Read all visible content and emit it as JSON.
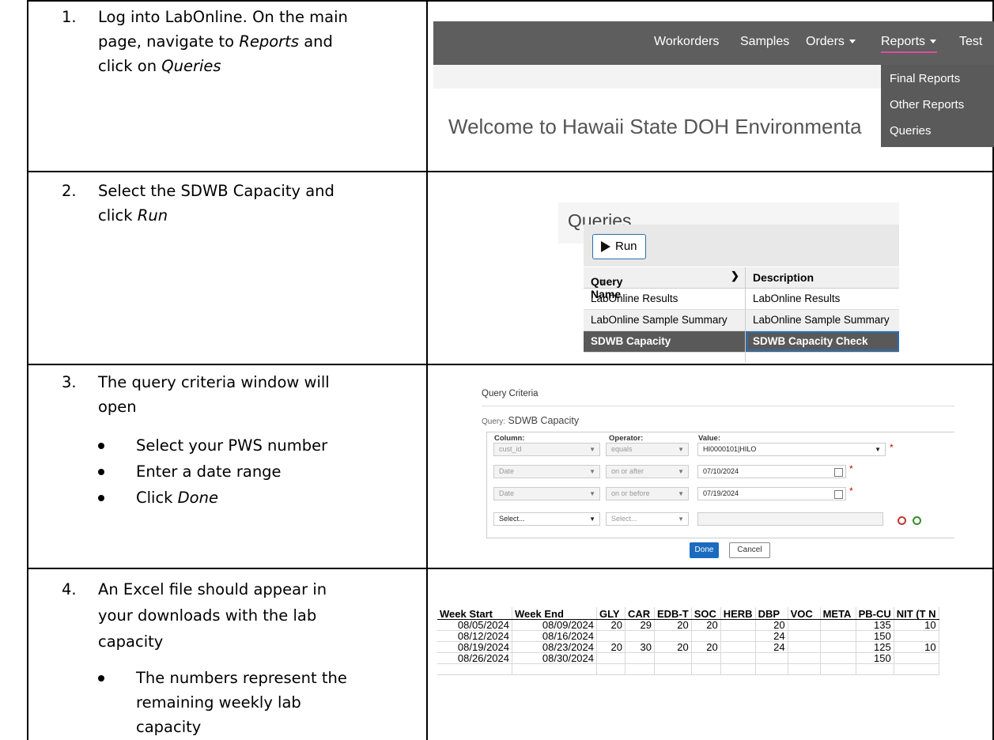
{
  "steps": [
    {
      "num": "1.",
      "line1": "Log into LabOnline. On the main",
      "line2_pre": "page, navigate to ",
      "line2_em": "Reports",
      "line2_post": " and",
      "line3_pre": "click on ",
      "line3_em": "Queries"
    },
    {
      "num": "2.",
      "line1": "Select the SDWB Capacity and",
      "line2_pre": "click ",
      "line2_em": "Run"
    },
    {
      "num": "3.",
      "line1": "The query criteria  window will",
      "line2": "open",
      "bullets": [
        "Select your PWS number",
        "Enter a date range"
      ],
      "bullet3_pre": "Click ",
      "bullet3_em": "Done"
    },
    {
      "num": "4.",
      "line1": "An Excel file should appear in",
      "line2": "your downloads with the lab",
      "line3": "capacity",
      "bullet_lines": [
        "The numbers represent the",
        "remaining weekly lab",
        "capacity"
      ]
    }
  ],
  "shot1": {
    "nav": [
      "Workorders",
      "Samples",
      "Orders",
      "Reports",
      "Test"
    ],
    "dropdown": [
      "Final Reports",
      "Other Reports",
      "Queries"
    ],
    "welcome": "Welcome to Hawaii State DOH Environmenta"
  },
  "shot2": {
    "title": "Queries",
    "run_label": "Run",
    "col_name": "Query Name",
    "col_sort": "↑",
    "col_desc": "Description",
    "rows": [
      {
        "name": "LabOnline Results",
        "desc": "LabOnline Results"
      },
      {
        "name": "LabOnline Sample Summary",
        "desc": "LabOnline Sample Summary"
      },
      {
        "name": "SDWB Capacity",
        "desc": "SDWB Capacity Check"
      }
    ]
  },
  "shot3": {
    "title": "Query Criteria",
    "query_label": "Query:",
    "query_name": "SDWB Capacity",
    "headers": {
      "column": "Column:",
      "operator": "Operator:",
      "value": "Value:"
    },
    "rows": [
      {
        "column": "cust_id",
        "operator": "equals",
        "value": "HI0000101|HILO"
      },
      {
        "column": "Date",
        "operator": "on or after",
        "value": "07/10/2024"
      },
      {
        "column": "Date",
        "operator": "on or before",
        "value": "07/19/2024"
      },
      {
        "column": "Select...",
        "operator": "Select...",
        "value": ""
      }
    ],
    "done": "Done",
    "cancel": "Cancel"
  },
  "shot4": {
    "headers": [
      "Week Start",
      "Week End",
      "GLY",
      "CAR",
      "EDB-T",
      "SOC",
      "HERB",
      "DBP",
      "VOC",
      "META",
      "PB-CU",
      "NIT (T N"
    ],
    "rows": [
      [
        "08/05/2024",
        "08/09/2024",
        "20",
        "29",
        "20",
        "20",
        "",
        "20",
        "",
        "",
        "135",
        "10"
      ],
      [
        "08/12/2024",
        "08/16/2024",
        "",
        "",
        "",
        "",
        "",
        "24",
        "",
        "",
        "150",
        ""
      ],
      [
        "08/19/2024",
        "08/23/2024",
        "20",
        "30",
        "20",
        "20",
        "",
        "24",
        "",
        "",
        "125",
        "10"
      ],
      [
        "08/26/2024",
        "08/30/2024",
        "",
        "",
        "",
        "",
        "",
        "",
        "",
        "",
        "150",
        ""
      ]
    ]
  }
}
